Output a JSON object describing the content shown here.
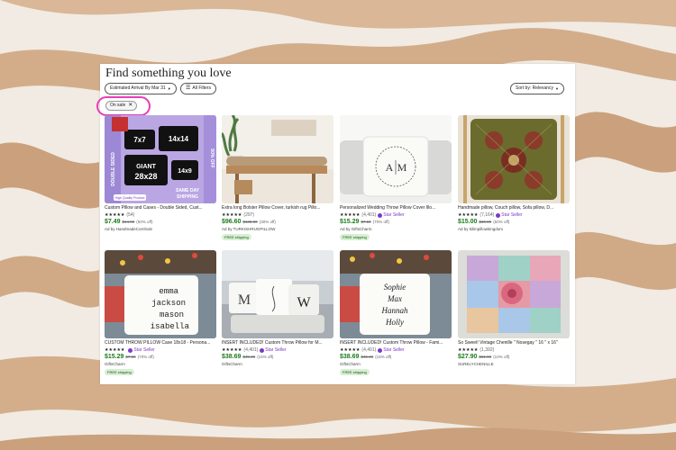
{
  "page": {
    "heading": "Find something you love"
  },
  "filters": {
    "estimated_arrival": "Estimated Arrival By Mar 31",
    "all_filters": "All Filters",
    "sort_by": "Sort by: Relevancy",
    "on_sale": "On sale"
  },
  "products": [
    {
      "title": "Custom Pillow and Cases - Double Sided, Cust...",
      "stars": "★★★★★",
      "reviews": "(54)",
      "star_seller": "",
      "price": "$7.49",
      "original_price": "$14.99",
      "discount": "(50% off)",
      "shop": "Ad by HandmadeCornhole",
      "shipping": "",
      "image_text": [
        "7x7",
        "14x14",
        "GIANT",
        "28x28",
        "14x9",
        "DOUBLE SIDED",
        "50% OFF",
        "SAME DAY",
        "SHIPPING",
        "High Quality Product"
      ]
    },
    {
      "title": "Extra long Bolster Pillow Cover, turkish rug Pillo...",
      "stars": "★★★★★",
      "reviews": "(297)",
      "star_seller": "",
      "price": "$96.60",
      "original_price": "$138.00",
      "discount": "(30% off)",
      "shop": "Ad by TURKISHRUGPILLOW",
      "shipping": "FREE shipping",
      "image_text": []
    },
    {
      "title": "Personalized Wedding Throw Pillow Cover Illo...",
      "stars": "★★★★★",
      "reviews": "(4,401)",
      "star_seller": "Star Seller",
      "price": "$15.29",
      "original_price": "$7.59",
      "discount": "(70% off)",
      "shop": "Ad by GiftsCharm",
      "shipping": "FREE shipping",
      "image_text": [
        "A",
        "M"
      ]
    },
    {
      "title": "Handmade pillow, Couch pillow, Sofa pillow, D...",
      "stars": "★★★★★",
      "reviews": "(7,164)",
      "star_seller": "Star Seller",
      "price": "$15.00",
      "original_price": "$30.00",
      "discount": "(50% off)",
      "shop": "Ad by kilimpillowkingdom",
      "shipping": "",
      "image_text": []
    },
    {
      "title": "CUSTOM THROW PILLOW Case 18x18 - Persona...",
      "stars": "★★★★★",
      "reviews": "",
      "star_seller": "Star Seller",
      "price": "$15.29",
      "original_price": "$7.59",
      "discount": "(70% off)",
      "shop": "GiftsCharm",
      "shipping": "FREE shipping",
      "image_text": [
        "emma",
        "jackson",
        "mason",
        "isabella"
      ]
    },
    {
      "title": "INSERT INCLUDED! Custom Throw Pillow for M...",
      "stars": "★★★★★",
      "reviews": "(4,401)",
      "star_seller": "Star Seller",
      "price": "$38.69",
      "original_price": "$45.49",
      "discount": "(15% off)",
      "shop": "GiftsCharm",
      "shipping": "",
      "image_text": [
        "M",
        "W"
      ]
    },
    {
      "title": "INSERT INCLUDED! Custom Throw Pillow - Fami...",
      "stars": "★★★★★",
      "reviews": "(4,401)",
      "star_seller": "Star Seller",
      "price": "$38.69",
      "original_price": "$45.49",
      "discount": "(15% off)",
      "shop": "GiftsCharm",
      "shipping": "FREE shipping",
      "image_text": [
        "Sophie",
        "Max",
        "Hannah",
        "Holly"
      ]
    },
    {
      "title": "So Sweet! Vintage Chenille \" Nosegay \" 16 \" x 16\"",
      "stars": "★★★★★",
      "reviews": "(1,392)",
      "star_seller": "",
      "price": "$27.90",
      "original_price": "$31.00",
      "discount": "(10% off)",
      "shop": "SURELYCHENILLE",
      "shipping": "",
      "image_text": []
    }
  ],
  "colors": {
    "price": "#1a7a1a",
    "star_seller": "#7b3ac2",
    "highlight": "#e63fb8",
    "free_shipping_bg": "#d7f0d2"
  }
}
